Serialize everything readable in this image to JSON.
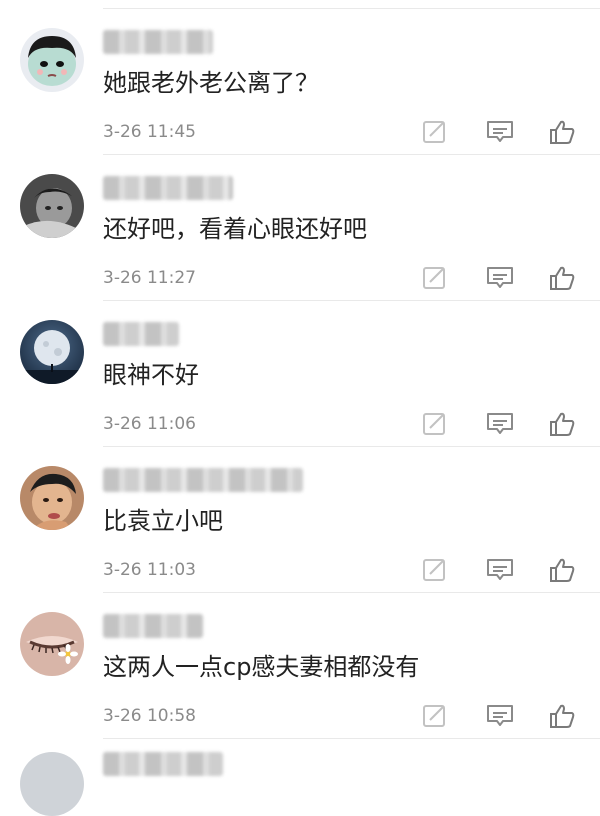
{
  "comments": [
    {
      "text": "她跟老外老公离了？",
      "time": "3-26 11:45",
      "avatar": "cartoon-girl-avatar"
    },
    {
      "text": "还好吧，看着心眼还好吧",
      "time": "3-26 11:27",
      "avatar": "child-photo-avatar"
    },
    {
      "text": "眼神不好",
      "time": "3-26 11:06",
      "avatar": "moon-avatar"
    },
    {
      "text": "比袁立小吧",
      "time": "3-26 11:03",
      "avatar": "kid-photo-avatar"
    },
    {
      "text": "这两人一点cp感夫妻相都没有",
      "time": "3-26 10:58",
      "avatar": "eye-flower-avatar"
    }
  ],
  "icons": {
    "edit": "edit-icon",
    "reply": "comment-icon",
    "like": "thumbs-up-icon"
  },
  "colors": {
    "text": "#222222",
    "meta": "#8a8a8a",
    "icon": "#9a9a9a",
    "divider": "#e9e9e9"
  }
}
